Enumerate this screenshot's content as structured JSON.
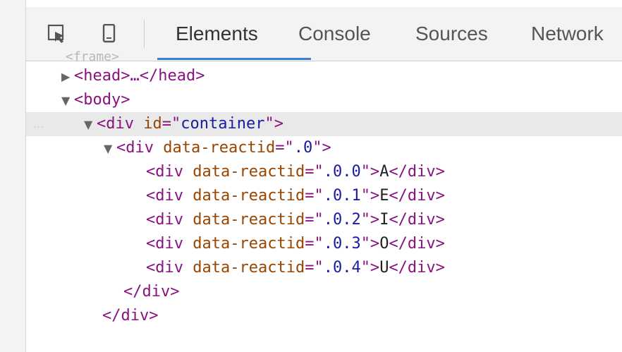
{
  "toolbar": {
    "tabs": [
      "Elements",
      "Console",
      "Sources",
      "Network"
    ],
    "active_tab": "Elements",
    "icons": [
      "inspect-element-icon",
      "device-toolbar-icon"
    ]
  },
  "tree": {
    "cut_text": "<frame>",
    "ellipsis": "...",
    "rows": [
      {
        "prefix": "<",
        "tag": "head",
        "suffix": ">…</head>"
      },
      {
        "prefix": "<",
        "tag": "body",
        "suffix": ">"
      },
      {
        "prefix": "<",
        "tag": "div",
        "attr": "id",
        "value": "container",
        "suffix": "\">"
      },
      {
        "prefix": "<",
        "tag": "div",
        "attr": "data-reactid",
        "value": ".0",
        "suffix": "\">"
      },
      {
        "prefix": "<",
        "tag": "div",
        "attr": "data-reactid",
        "value": ".0.0",
        "text": "A",
        "close": "</div>"
      },
      {
        "prefix": "<",
        "tag": "div",
        "attr": "data-reactid",
        "value": ".0.1",
        "text": "E",
        "close": "</div>"
      },
      {
        "prefix": "<",
        "tag": "div",
        "attr": "data-reactid",
        "value": ".0.2",
        "text": "I",
        "close": "</div>"
      },
      {
        "prefix": "<",
        "tag": "div",
        "attr": "data-reactid",
        "value": ".0.3",
        "text": "O",
        "close": "</div>"
      },
      {
        "prefix": "<",
        "tag": "div",
        "attr": "data-reactid",
        "value": ".0.4",
        "text": "U",
        "close": "</div>"
      },
      {
        "close": "</div>"
      },
      {
        "close": "</div>"
      }
    ]
  },
  "colors": {
    "tag": "#881280",
    "attribute": "#994500",
    "value": "#1a1aa6",
    "selection": "#e9e9e9",
    "active_tab": "#3b7ddd"
  }
}
